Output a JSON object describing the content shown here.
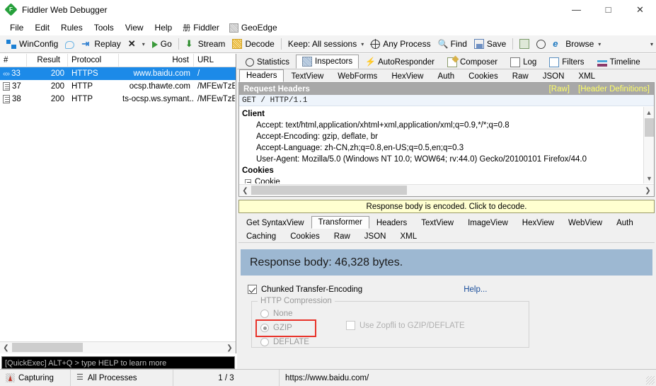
{
  "window": {
    "title": "Fiddler Web Debugger",
    "app_icon": "fiddler-diamond-icon",
    "minimize": "—",
    "maximize": "□",
    "close": "✕"
  },
  "menubar": {
    "items": [
      {
        "label": "File",
        "icon": null
      },
      {
        "label": "Edit",
        "icon": null
      },
      {
        "label": "Rules",
        "icon": null
      },
      {
        "label": "Tools",
        "icon": null
      },
      {
        "label": "View",
        "icon": null
      },
      {
        "label": "Help",
        "icon": null
      },
      {
        "label": "Fiddler",
        "icon": "册"
      },
      {
        "label": "GeoEdge",
        "icon": "geoedge-icon"
      }
    ]
  },
  "toolbar": {
    "winconfig": "WinConfig",
    "comment_icon": "comment-bubble-icon",
    "replay": "Replay",
    "remove": "✕",
    "go": "Go",
    "stream": "Stream",
    "decode": "Decode",
    "keep": "Keep: All sessions",
    "any_process": "Any Process",
    "find": "Find",
    "save": "Save",
    "copy_icon": "copy-icon",
    "timer_icon": "timer-icon",
    "browse": "Browse",
    "overflow": "»"
  },
  "sessions": {
    "columns": [
      "#",
      "Result",
      "Protocol",
      "Host",
      "URL"
    ],
    "rows": [
      {
        "icon": "arrows-icon",
        "num": "33",
        "result": "200",
        "protocol": "HTTPS",
        "host": "www.baidu.com",
        "url": "/",
        "selected": true
      },
      {
        "icon": "document-icon",
        "num": "37",
        "result": "200",
        "protocol": "HTTP",
        "host": "ocsp.thawte.com",
        "url": "/MFEwTzBN",
        "selected": false
      },
      {
        "icon": "document-icon",
        "num": "38",
        "result": "200",
        "protocol": "HTTP",
        "host": "ts-ocsp.ws.symant...",
        "url": "/MFEwTzBN",
        "selected": false
      }
    ]
  },
  "quickexec": {
    "text": "[QuickExec] ALT+Q > type HELP to learn more"
  },
  "inspector": {
    "tabs": [
      {
        "label": "Statistics",
        "icon": "stopwatch-icon",
        "active": false
      },
      {
        "label": "Inspectors",
        "icon": "magnifier-icon",
        "active": true
      },
      {
        "label": "AutoResponder",
        "icon": "lightning-icon",
        "active": false
      },
      {
        "label": "Composer",
        "icon": "compose-icon",
        "active": false
      },
      {
        "label": "Log",
        "icon": "log-icon",
        "active": false
      },
      {
        "label": "Filters",
        "icon": "filters-icon",
        "active": false
      },
      {
        "label": "Timeline",
        "icon": "timeline-icon",
        "active": false
      }
    ],
    "request_tabs": [
      {
        "label": "Headers",
        "active": true
      },
      {
        "label": "TextView",
        "active": false
      },
      {
        "label": "WebForms",
        "active": false
      },
      {
        "label": "HexView",
        "active": false
      },
      {
        "label": "Auth",
        "active": false
      },
      {
        "label": "Cookies",
        "active": false
      },
      {
        "label": "Raw",
        "active": false
      },
      {
        "label": "JSON",
        "active": false
      },
      {
        "label": "XML",
        "active": false
      }
    ],
    "request_headers": {
      "title": "Request Headers",
      "link_raw": "[Raw]",
      "link_defs": "[Header Definitions]",
      "request_line": "GET / HTTP/1.1",
      "groups": [
        {
          "name": "Client",
          "lines": [
            "Accept: text/html,application/xhtml+xml,application/xml;q=0.9,*/*;q=0.8",
            "Accept-Encoding: gzip, deflate, br",
            "Accept-Language: zh-CN,zh;q=0.8,en-US;q=0.5,en;q=0.3",
            "User-Agent: Mozilla/5.0 (Windows NT 10.0; WOW64; rv:44.0) Gecko/20100101 Firefox/44.0"
          ]
        },
        {
          "name": "Cookies",
          "tree_item": "Cookie",
          "lines": []
        }
      ]
    }
  },
  "response": {
    "notice": "Response body is encoded. Click to decode.",
    "tabs_row1": [
      {
        "label": "Get SyntaxView",
        "active": false
      },
      {
        "label": "Transformer",
        "active": true
      },
      {
        "label": "Headers",
        "active": false
      },
      {
        "label": "TextView",
        "active": false
      },
      {
        "label": "ImageView",
        "active": false
      },
      {
        "label": "HexView",
        "active": false
      },
      {
        "label": "WebView",
        "active": false
      },
      {
        "label": "Auth",
        "active": false
      }
    ],
    "tabs_row2": [
      {
        "label": "Caching",
        "active": false
      },
      {
        "label": "Cookies",
        "active": false
      },
      {
        "label": "Raw",
        "active": false
      },
      {
        "label": "JSON",
        "active": false
      },
      {
        "label": "XML",
        "active": false
      }
    ],
    "transformer": {
      "body_banner": "Response body: 46,328 bytes.",
      "chunked_label": "Chunked Transfer-Encoding",
      "chunked_checked": true,
      "help_link": "Help...",
      "group_title": "HTTP Compression",
      "options": [
        {
          "label": "None",
          "selected": false
        },
        {
          "label": "GZIP",
          "selected": true,
          "highlighted": true
        },
        {
          "label": "DEFLATE",
          "selected": false
        }
      ],
      "zopfli_label": "Use Zopfli to GZIP/DEFLATE",
      "zopfli_checked": false,
      "highlight_color": "#e8332a"
    }
  },
  "statusbar": {
    "capturing": "Capturing",
    "processes": "All Processes",
    "count": "1 / 3",
    "url": "https://www.baidu.com/"
  },
  "colors": {
    "selection_blue": "#1c8ae8",
    "banner_blue": "#9db8d2",
    "notice_yellow": "#ffffd0",
    "header_gray": "#a8a8a8",
    "link_yellow": "#ffff66"
  }
}
